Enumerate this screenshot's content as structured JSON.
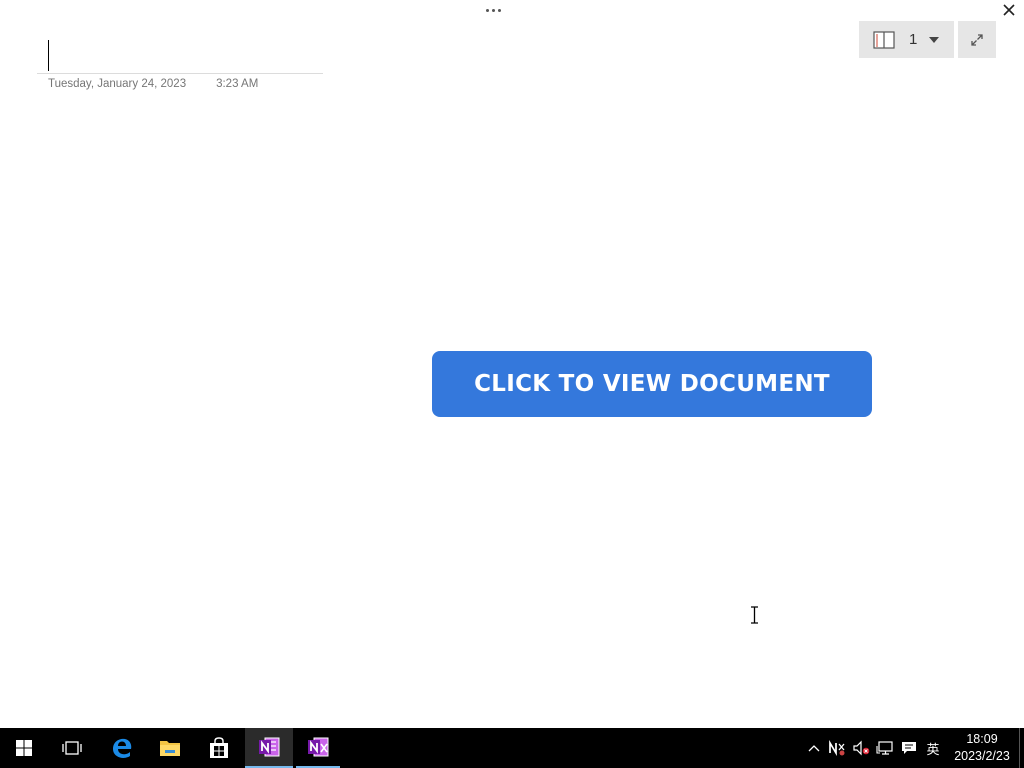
{
  "window": {
    "page_count": "1"
  },
  "note": {
    "date": "Tuesday, January 24, 2023",
    "time": "3:23 AM"
  },
  "content": {
    "cta_label": "CLICK TO VIEW DOCUMENT",
    "cta_color": "#3478dc"
  },
  "taskbar": {
    "items": [
      "windows-start-icon",
      "task-view-icon",
      "edge-icon",
      "file-explorer-icon",
      "store-icon",
      "onenote-icon",
      "onenote-clipper-icon"
    ],
    "tray_icons": [
      "chevron-up-icon",
      "onenote-tray-icon",
      "volume-muted-icon",
      "network-icon",
      "action-center-icon"
    ],
    "ime": "英",
    "clock_time": "18:09",
    "clock_date": "2023/2/23"
  }
}
